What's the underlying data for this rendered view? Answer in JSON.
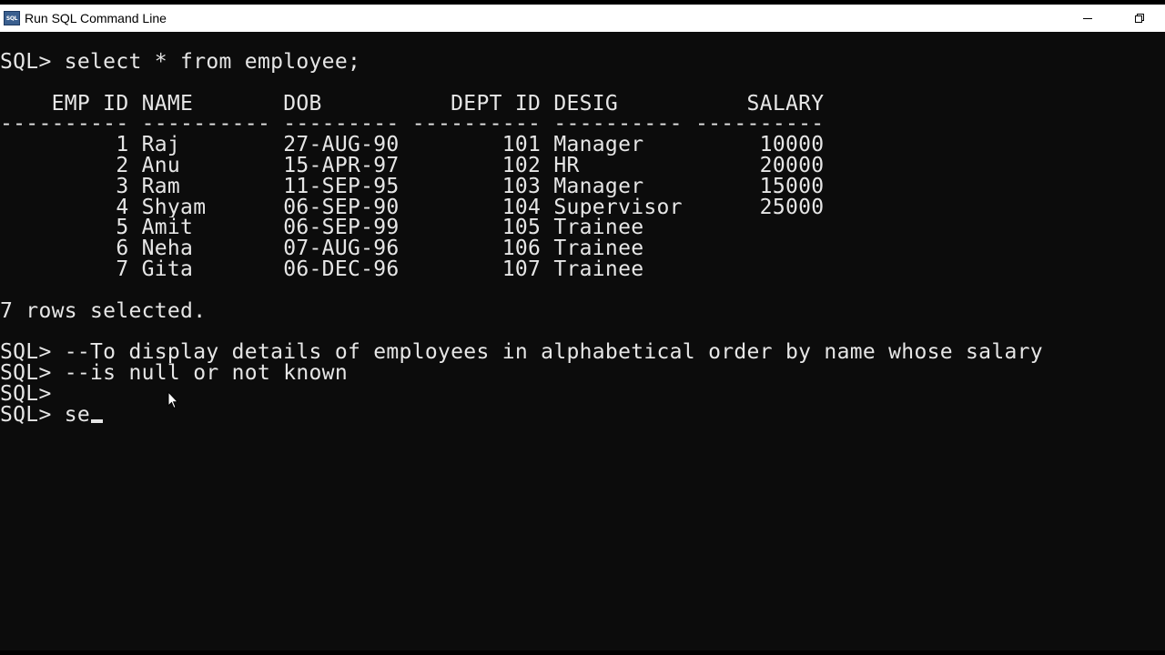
{
  "window": {
    "title": "Run SQL Command Line",
    "app_icon_label": "SQL",
    "minimize_icon": "minimize-icon",
    "restore_icon": "restore-icon"
  },
  "console": {
    "lines": [
      "SQL> select * from employee;",
      "",
      "    EMP_ID NAME       DOB          DEPT_ID DESIG          SALARY",
      "---------- ---------- --------- ---------- ---------- ----------",
      "         1 Raj        27-AUG-90        101 Manager         10000",
      "         2 Anu        15-APR-97        102 HR              20000",
      "         3 Ram        11-SEP-95        103 Manager         15000",
      "         4 Shyam      06-SEP-90        104 Supervisor      25000",
      "         5 Amit       06-SEP-99        105 Trainee",
      "         6 Neha       07-AUG-96        106 Trainee",
      "         7 Gita       06-DEC-96        107 Trainee",
      "",
      "7 rows selected.",
      "",
      "SQL> --To display details of employees in alphabetical order by name whose salary",
      "SQL> --is null or not known",
      "SQL>",
      "SQL> se"
    ]
  }
}
